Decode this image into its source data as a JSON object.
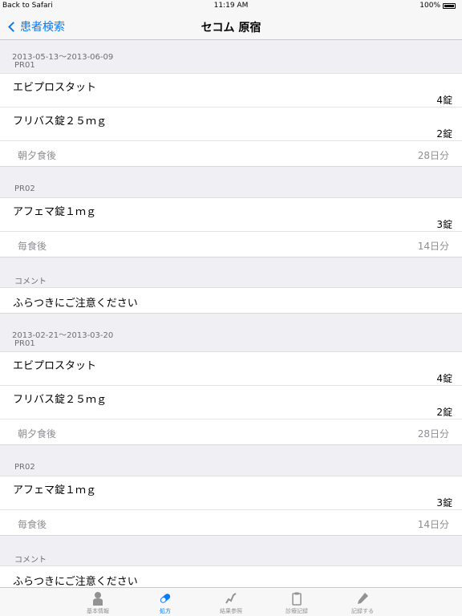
{
  "status_bar": {
    "back": "Back to Safari",
    "time": "11:19 AM",
    "battery": "100%"
  },
  "nav": {
    "back": "患者検索",
    "title": "セコム 原宿"
  },
  "p1": {
    "date": "2013-05-13～2013-06-09",
    "g1": {
      "label": "PR01",
      "d1": {
        "name": "エビプロスタット",
        "qty": "4錠"
      },
      "d2": {
        "name": "フリバス錠２５ｍｇ",
        "qty": "2錠"
      },
      "usage": "朝夕食後",
      "days": "28日分"
    },
    "g2": {
      "label": "PR02",
      "d1": {
        "name": "アフェマ錠１ｍｇ",
        "qty": "3錠"
      },
      "usage": "毎食後",
      "days": "14日分"
    },
    "comment_label": "コメント",
    "comment": "ふらつきにご注意ください"
  },
  "p2": {
    "date": "2013-02-21～2013-03-20",
    "g1": {
      "label": "PR01",
      "d1": {
        "name": "エビプロスタット",
        "qty": "4錠"
      },
      "d2": {
        "name": "フリバス錠２５ｍｇ",
        "qty": "2錠"
      },
      "usage": "朝夕食後",
      "days": "28日分"
    },
    "g2": {
      "label": "PR02",
      "d1": {
        "name": "アフェマ錠１ｍｇ",
        "qty": "3錠"
      },
      "usage": "毎食後",
      "days": "14日分"
    },
    "comment_label": "コメント",
    "comment": "ふらつきにご注意ください"
  },
  "tabs": [
    {
      "label": "基本情報",
      "icon": "person-icon"
    },
    {
      "label": "処方",
      "icon": "pill-icon",
      "active": true
    },
    {
      "label": "結果参照",
      "icon": "chart-icon"
    },
    {
      "label": "診療記録",
      "icon": "clipboard-icon"
    },
    {
      "label": "記録する",
      "icon": "pencil-icon"
    }
  ],
  "colors": {
    "accent": "#007aff",
    "tab_inactive": "#929292",
    "background": "#efeff4"
  }
}
